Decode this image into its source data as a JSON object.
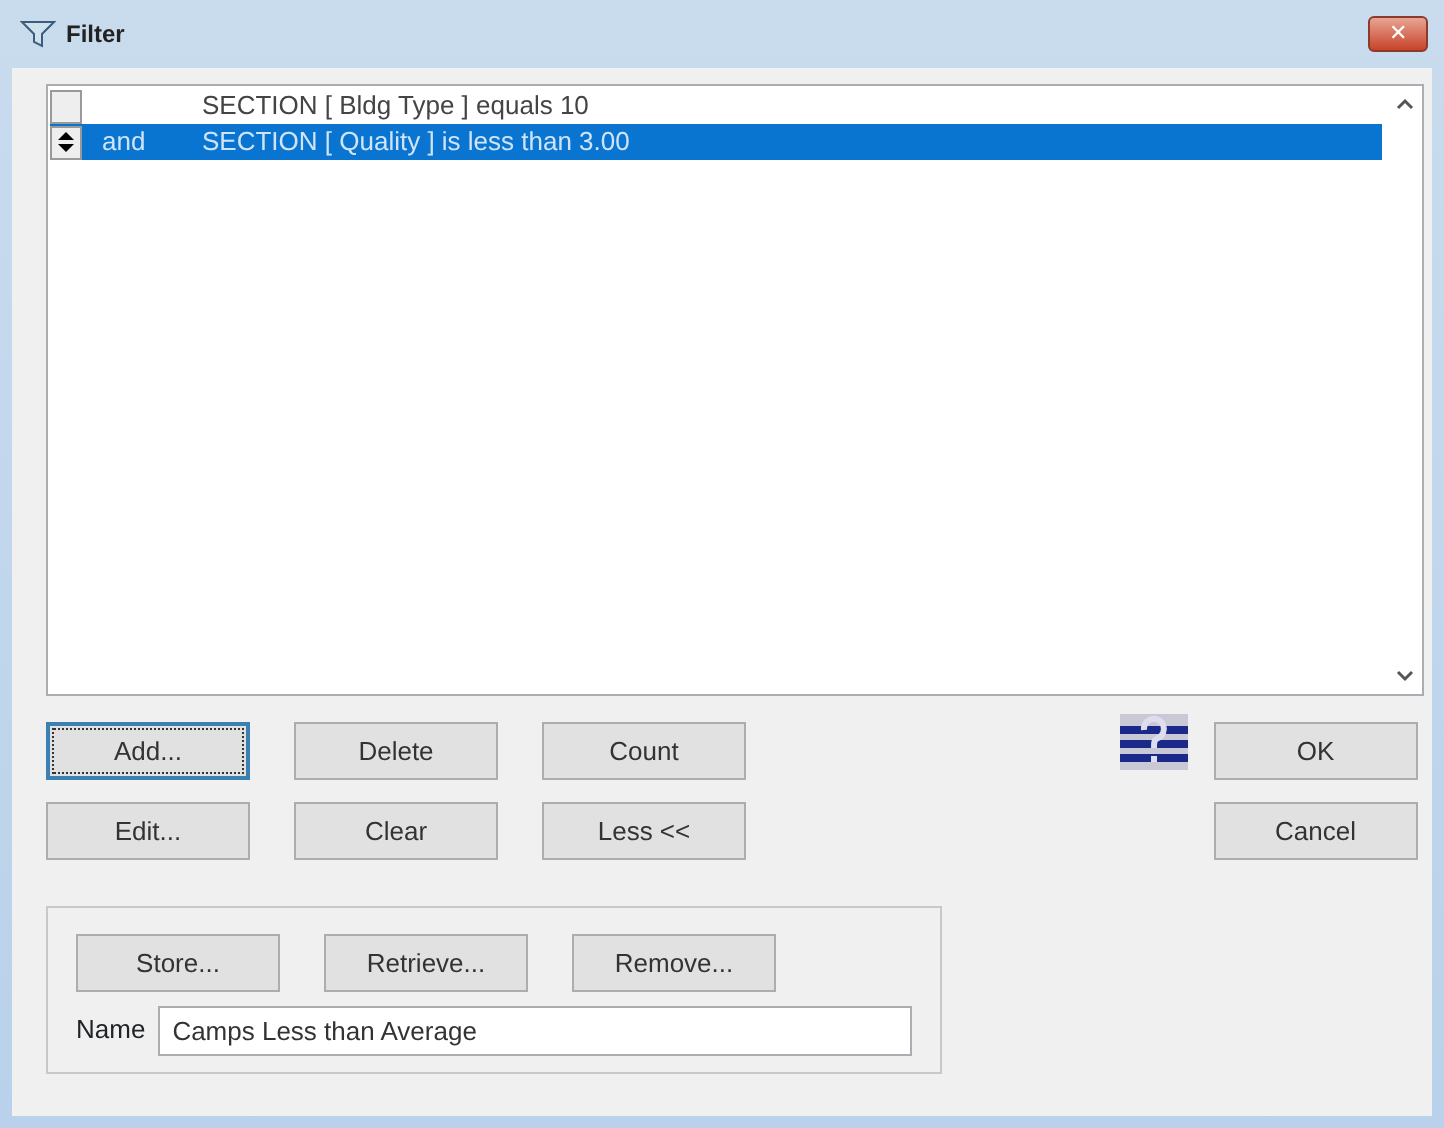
{
  "window": {
    "title": "Filter",
    "close": "✕"
  },
  "conditions": [
    {
      "text": "SECTION [ Bldg Type ] equals 10",
      "selected": false
    },
    {
      "connector": "and",
      "text": "SECTION [ Quality ] is less than 3.00",
      "selected": true
    }
  ],
  "buttons": [
    {
      "label": "Add...",
      "focused": true
    },
    {
      "label": "Delete",
      "focused": false
    },
    {
      "label": "Count",
      "focused": false
    },
    {
      "label": "Edit...",
      "focused": false
    },
    {
      "label": "Clear",
      "focused": false
    },
    {
      "label": "Less <<",
      "focused": false
    }
  ],
  "dialog_buttons": [
    "OK",
    "Cancel"
  ],
  "stored": {
    "buttons": [
      "Store...",
      "Retrieve...",
      "Remove..."
    ],
    "name_label": "Name",
    "name_value": "Camps Less than Average"
  }
}
